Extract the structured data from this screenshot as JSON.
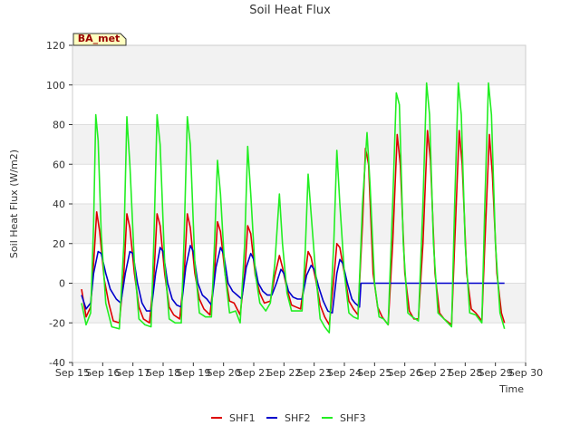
{
  "chart_data": {
    "type": "line",
    "title": "Soil Heat Flux",
    "xlabel": "Time",
    "ylabel": "Soil Heat Flux (W/m2)",
    "badge": "BA_met",
    "xlim": [
      15,
      30
    ],
    "ylim": [
      -40,
      120
    ],
    "x_ticks": [
      {
        "x": 15,
        "label": "Sep 15"
      },
      {
        "x": 16,
        "label": "Sep 16"
      },
      {
        "x": 17,
        "label": "Sep 17"
      },
      {
        "x": 18,
        "label": "Sep 18"
      },
      {
        "x": 19,
        "label": "Sep 19"
      },
      {
        "x": 20,
        "label": "Sep 20"
      },
      {
        "x": 21,
        "label": "Sep 21"
      },
      {
        "x": 22,
        "label": "Sep 22"
      },
      {
        "x": 23,
        "label": "Sep 23"
      },
      {
        "x": 24,
        "label": "Sep 24"
      },
      {
        "x": 25,
        "label": "Sep 25"
      },
      {
        "x": 26,
        "label": "Sep 26"
      },
      {
        "x": 27,
        "label": "Sep 27"
      },
      {
        "x": 28,
        "label": "Sep 28"
      },
      {
        "x": 29,
        "label": "Sep 29"
      },
      {
        "x": 30,
        "label": "Sep 30"
      }
    ],
    "y_ticks": [
      -40,
      -20,
      0,
      20,
      40,
      60,
      80,
      100,
      120
    ],
    "legend_position": "bottom-center",
    "grid": true,
    "series": [
      {
        "name": "SHF1",
        "color": "#dd0000",
        "points": [
          [
            15.3,
            -3
          ],
          [
            15.45,
            -17
          ],
          [
            15.6,
            -12
          ],
          [
            15.7,
            10
          ],
          [
            15.8,
            36
          ],
          [
            15.9,
            26
          ],
          [
            16.05,
            2
          ],
          [
            16.2,
            -10
          ],
          [
            16.35,
            -19
          ],
          [
            16.55,
            -20
          ],
          [
            16.7,
            5
          ],
          [
            16.8,
            35
          ],
          [
            16.9,
            28
          ],
          [
            17.05,
            5
          ],
          [
            17.2,
            -12
          ],
          [
            17.35,
            -18
          ],
          [
            17.55,
            -20
          ],
          [
            17.7,
            5
          ],
          [
            17.8,
            35
          ],
          [
            17.9,
            29
          ],
          [
            18.05,
            5
          ],
          [
            18.2,
            -12
          ],
          [
            18.35,
            -16
          ],
          [
            18.55,
            -18
          ],
          [
            18.7,
            5
          ],
          [
            18.8,
            35
          ],
          [
            18.9,
            28
          ],
          [
            19.05,
            5
          ],
          [
            19.2,
            -8
          ],
          [
            19.35,
            -13
          ],
          [
            19.55,
            -16
          ],
          [
            19.7,
            5
          ],
          [
            19.8,
            31
          ],
          [
            19.9,
            26
          ],
          [
            20.05,
            5
          ],
          [
            20.2,
            -9
          ],
          [
            20.35,
            -10
          ],
          [
            20.55,
            -16
          ],
          [
            20.7,
            5
          ],
          [
            20.8,
            29
          ],
          [
            20.9,
            25
          ],
          [
            21.05,
            4
          ],
          [
            21.2,
            -5
          ],
          [
            21.35,
            -10
          ],
          [
            21.55,
            -9
          ],
          [
            21.7,
            4
          ],
          [
            21.85,
            14
          ],
          [
            21.95,
            8
          ],
          [
            22.1,
            -3
          ],
          [
            22.25,
            -11
          ],
          [
            22.4,
            -12
          ],
          [
            22.55,
            -13
          ],
          [
            22.7,
            4
          ],
          [
            22.8,
            16
          ],
          [
            22.9,
            13
          ],
          [
            23.05,
            2
          ],
          [
            23.2,
            -11
          ],
          [
            23.35,
            -17
          ],
          [
            23.5,
            -21
          ],
          [
            23.65,
            2
          ],
          [
            23.75,
            20
          ],
          [
            23.85,
            18
          ],
          [
            24.0,
            5
          ],
          [
            24.15,
            -9
          ],
          [
            24.3,
            -13
          ],
          [
            24.45,
            -16
          ],
          [
            24.6,
            30
          ],
          [
            24.7,
            68
          ],
          [
            24.8,
            60
          ],
          [
            24.95,
            5
          ],
          [
            25.1,
            -12
          ],
          [
            25.25,
            -17
          ],
          [
            25.45,
            -21
          ],
          [
            25.6,
            20
          ],
          [
            25.75,
            75
          ],
          [
            25.85,
            60
          ],
          [
            26.0,
            5
          ],
          [
            26.15,
            -14
          ],
          [
            26.3,
            -18
          ],
          [
            26.45,
            -18
          ],
          [
            26.6,
            20
          ],
          [
            26.75,
            77
          ],
          [
            26.85,
            62
          ],
          [
            27.0,
            5
          ],
          [
            27.15,
            -15
          ],
          [
            27.3,
            -18
          ],
          [
            27.55,
            -21
          ],
          [
            27.65,
            20
          ],
          [
            27.8,
            77
          ],
          [
            27.9,
            60
          ],
          [
            28.05,
            5
          ],
          [
            28.2,
            -13
          ],
          [
            28.35,
            -15
          ],
          [
            28.55,
            -19
          ],
          [
            28.65,
            20
          ],
          [
            28.8,
            75
          ],
          [
            28.9,
            55
          ],
          [
            29.05,
            5
          ],
          [
            29.2,
            -15
          ],
          [
            29.3,
            -20
          ]
        ]
      },
      {
        "name": "SHF2",
        "color": "#0000cc",
        "points": [
          [
            15.3,
            -6
          ],
          [
            15.45,
            -13
          ],
          [
            15.6,
            -10
          ],
          [
            15.7,
            5
          ],
          [
            15.85,
            16
          ],
          [
            15.95,
            15
          ],
          [
            16.1,
            5
          ],
          [
            16.25,
            -3
          ],
          [
            16.45,
            -8
          ],
          [
            16.6,
            -10
          ],
          [
            16.75,
            5
          ],
          [
            16.9,
            16
          ],
          [
            17.0,
            15
          ],
          [
            17.15,
            0
          ],
          [
            17.3,
            -10
          ],
          [
            17.45,
            -14
          ],
          [
            17.6,
            -14
          ],
          [
            17.75,
            5
          ],
          [
            17.9,
            18
          ],
          [
            18.0,
            16
          ],
          [
            18.15,
            0
          ],
          [
            18.3,
            -8
          ],
          [
            18.45,
            -11
          ],
          [
            18.6,
            -12
          ],
          [
            18.75,
            8
          ],
          [
            18.9,
            19
          ],
          [
            19.0,
            16
          ],
          [
            19.15,
            0
          ],
          [
            19.3,
            -6
          ],
          [
            19.45,
            -8
          ],
          [
            19.6,
            -11
          ],
          [
            19.75,
            8
          ],
          [
            19.9,
            18
          ],
          [
            20.0,
            15
          ],
          [
            20.15,
            0
          ],
          [
            20.3,
            -4
          ],
          [
            20.45,
            -6
          ],
          [
            20.6,
            -8
          ],
          [
            20.75,
            8
          ],
          [
            20.9,
            15
          ],
          [
            21.0,
            12
          ],
          [
            21.15,
            0
          ],
          [
            21.3,
            -4
          ],
          [
            21.45,
            -6
          ],
          [
            21.6,
            -6
          ],
          [
            21.75,
            0
          ],
          [
            21.9,
            7
          ],
          [
            22.0,
            5
          ],
          [
            22.15,
            -4
          ],
          [
            22.3,
            -7
          ],
          [
            22.45,
            -8
          ],
          [
            22.6,
            -8
          ],
          [
            22.75,
            4
          ],
          [
            22.9,
            9
          ],
          [
            23.0,
            7
          ],
          [
            23.15,
            -2
          ],
          [
            23.3,
            -9
          ],
          [
            23.45,
            -14
          ],
          [
            23.6,
            -15
          ],
          [
            23.75,
            5
          ],
          [
            23.85,
            12
          ],
          [
            23.95,
            10
          ],
          [
            24.1,
            0
          ],
          [
            24.25,
            -8
          ],
          [
            24.35,
            -10
          ],
          [
            24.5,
            -12
          ],
          [
            24.55,
            0
          ],
          [
            25.0,
            0
          ],
          [
            26.0,
            0
          ],
          [
            27.0,
            0
          ],
          [
            28.0,
            0
          ],
          [
            29.0,
            0
          ],
          [
            29.3,
            0
          ]
        ]
      },
      {
        "name": "SHF3",
        "color": "#22ee22",
        "points": [
          [
            15.3,
            -10
          ],
          [
            15.45,
            -21
          ],
          [
            15.6,
            -15
          ],
          [
            15.7,
            30
          ],
          [
            15.77,
            85
          ],
          [
            15.85,
            72
          ],
          [
            15.95,
            25
          ],
          [
            16.1,
            -10
          ],
          [
            16.3,
            -22
          ],
          [
            16.55,
            -23
          ],
          [
            16.7,
            20
          ],
          [
            16.8,
            84
          ],
          [
            16.9,
            60
          ],
          [
            17.05,
            10
          ],
          [
            17.2,
            -18
          ],
          [
            17.4,
            -21
          ],
          [
            17.6,
            -22
          ],
          [
            17.7,
            25
          ],
          [
            17.8,
            85
          ],
          [
            17.9,
            70
          ],
          [
            18.05,
            10
          ],
          [
            18.2,
            -18
          ],
          [
            18.4,
            -20
          ],
          [
            18.6,
            -20
          ],
          [
            18.7,
            25
          ],
          [
            18.8,
            84
          ],
          [
            18.9,
            70
          ],
          [
            19.05,
            10
          ],
          [
            19.2,
            -15
          ],
          [
            19.4,
            -17
          ],
          [
            19.6,
            -17
          ],
          [
            19.7,
            20
          ],
          [
            19.8,
            62
          ],
          [
            19.9,
            45
          ],
          [
            20.05,
            5
          ],
          [
            20.2,
            -15
          ],
          [
            20.4,
            -14
          ],
          [
            20.55,
            -20
          ],
          [
            20.7,
            20
          ],
          [
            20.8,
            69
          ],
          [
            20.9,
            45
          ],
          [
            21.05,
            5
          ],
          [
            21.2,
            -10
          ],
          [
            21.4,
            -14
          ],
          [
            21.55,
            -10
          ],
          [
            21.7,
            10
          ],
          [
            21.85,
            45
          ],
          [
            21.95,
            20
          ],
          [
            22.1,
            -5
          ],
          [
            22.25,
            -14
          ],
          [
            22.4,
            -14
          ],
          [
            22.6,
            -14
          ],
          [
            22.7,
            15
          ],
          [
            22.8,
            55
          ],
          [
            22.9,
            35
          ],
          [
            23.05,
            5
          ],
          [
            23.2,
            -18
          ],
          [
            23.35,
            -22
          ],
          [
            23.5,
            -25
          ],
          [
            23.65,
            20
          ],
          [
            23.75,
            67
          ],
          [
            23.85,
            40
          ],
          [
            24.0,
            5
          ],
          [
            24.15,
            -15
          ],
          [
            24.3,
            -17
          ],
          [
            24.45,
            -18
          ],
          [
            24.6,
            40
          ],
          [
            24.75,
            76
          ],
          [
            24.85,
            50
          ],
          [
            25.0,
            0
          ],
          [
            25.15,
            -17
          ],
          [
            25.3,
            -18
          ],
          [
            25.45,
            -21
          ],
          [
            25.6,
            40
          ],
          [
            25.72,
            96
          ],
          [
            25.82,
            90
          ],
          [
            25.95,
            20
          ],
          [
            26.1,
            -15
          ],
          [
            26.25,
            -17
          ],
          [
            26.45,
            -19
          ],
          [
            26.6,
            40
          ],
          [
            26.72,
            101
          ],
          [
            26.82,
            85
          ],
          [
            26.95,
            20
          ],
          [
            27.1,
            -15
          ],
          [
            27.3,
            -18
          ],
          [
            27.55,
            -22
          ],
          [
            27.65,
            40
          ],
          [
            27.77,
            101
          ],
          [
            27.87,
            85
          ],
          [
            28.0,
            20
          ],
          [
            28.15,
            -15
          ],
          [
            28.35,
            -16
          ],
          [
            28.55,
            -20
          ],
          [
            28.65,
            40
          ],
          [
            28.77,
            101
          ],
          [
            28.87,
            85
          ],
          [
            29.0,
            20
          ],
          [
            29.15,
            -15
          ],
          [
            29.3,
            -23
          ]
        ]
      }
    ]
  }
}
